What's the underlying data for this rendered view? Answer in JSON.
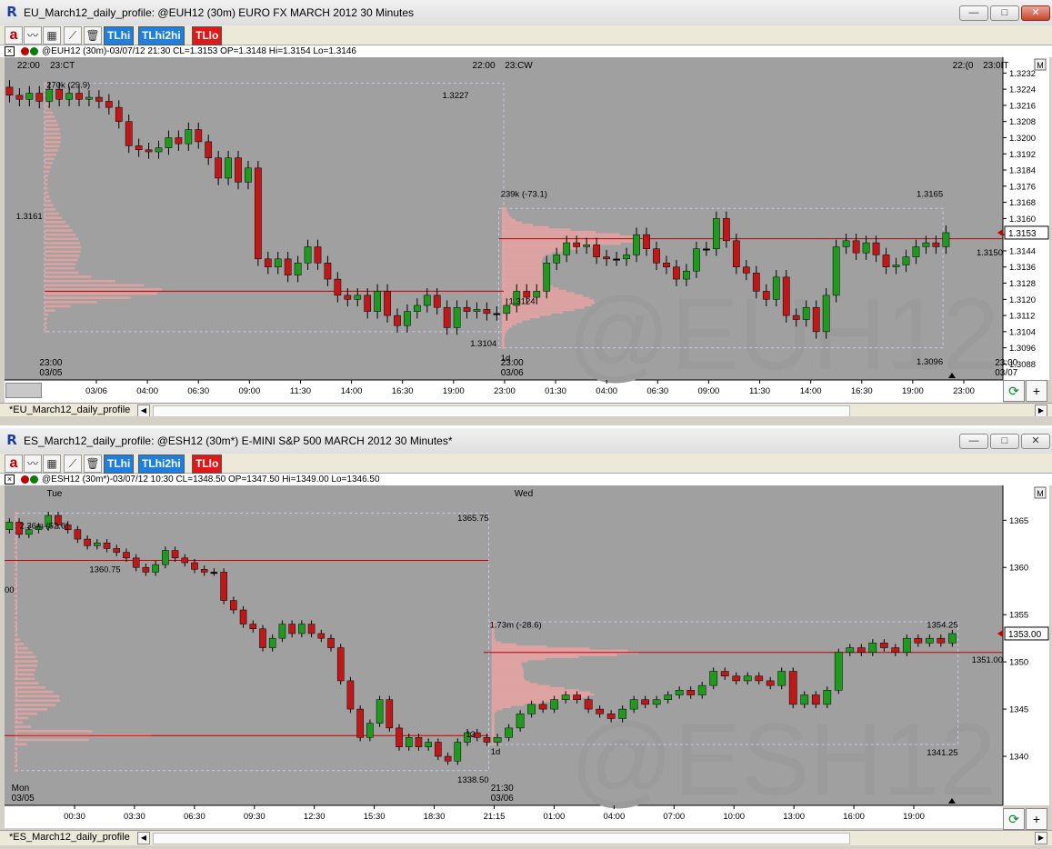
{
  "panes": [
    {
      "title": "EU_March12_daily_profile: @EUH12 (30m) EURO FX MARCH 2012 30 Minutes",
      "app_icon": "R",
      "window_buttons": {
        "minimize": "—",
        "maximize": "□",
        "close": "✕"
      },
      "toolbar": {
        "a_label": "a",
        "tlhi": "TLhi",
        "tlhi2hi": "TLhi2hi",
        "tllo": "TLlo"
      },
      "info": "@EUH12 (30m)-03/07/12 21:30 CL=1.3153 OP=1.3148 Hi=1.3154 Lo=1.3146",
      "tab_name": "*EU_March12_daily_profile",
      "watermark": "@EUH12",
      "top_labels": [
        {
          "text": "22:00",
          "x": 0.024
        },
        {
          "text": "23:CT",
          "x": 0.058
        },
        {
          "text": "22:00",
          "x": 0.48
        },
        {
          "text": "23:CW",
          "x": 0.515
        },
        {
          "text": "22:(0",
          "x": 0.96
        },
        {
          "text": "23:0IT",
          "x": 0.993
        }
      ],
      "profile_labels": [
        {
          "text": "270k (29.9)",
          "xf": 0.042,
          "price": 1.3226
        },
        {
          "text": "1.3227",
          "xf": 0.465,
          "price": 1.3221,
          "anchor": "end"
        },
        {
          "text": "1.3161",
          "xf": 0.038,
          "price": 1.3161,
          "anchor": "end"
        },
        {
          "text": "1.3124",
          "xf": 0.505,
          "price": 1.3119
        },
        {
          "text": "1.3104",
          "xf": 0.493,
          "price": 1.3098,
          "anchor": "end"
        },
        {
          "text": "1d",
          "xf": 0.497,
          "price": 1.3091
        },
        {
          "text": "239k (-73.1)",
          "xf": 0.497,
          "price": 1.3172
        },
        {
          "text": "1.3165",
          "xf": 0.94,
          "price": 1.3172,
          "anchor": "end"
        },
        {
          "text": "1.3150",
          "xf": 1.0,
          "price": 1.3143,
          "anchor": "end"
        },
        {
          "text": "1.3096",
          "xf": 0.94,
          "price": 1.3089,
          "anchor": "end"
        }
      ],
      "date_labels": [
        {
          "t1": "23:00",
          "t2": "03/05",
          "x": 0.035
        },
        {
          "t1": "23:00",
          "t2": "03/06",
          "x": 0.497
        },
        {
          "t1": "23:00",
          "t2": "03/07",
          "x": 0.992
        }
      ],
      "chart_data": {
        "type": "candlestick",
        "ylim": [
          1.3081,
          1.3238
        ],
        "y_ticks": [
          "1.3232",
          "1.3224",
          "1.3216",
          "1.3208",
          "1.3200",
          "1.3192",
          "1.3184",
          "1.3176",
          "1.3168",
          "1.3160",
          "1.3152",
          "1.3144",
          "1.3136",
          "1.3128",
          "1.3120",
          "1.3112",
          "1.3104",
          "1.3096",
          "1.3088"
        ],
        "x_ticks": [
          "03/06",
          "04:00",
          "06:30",
          "09:00",
          "11:30",
          "14:00",
          "16:30",
          "19:00",
          "23:00",
          "01:30",
          "04:00",
          "06:30",
          "09:00",
          "11:30",
          "14:00",
          "16:30",
          "19:00",
          "23:00"
        ],
        "last_price": "1.3153",
        "red_lines": [
          {
            "y": 1.3124,
            "x0": 0.04,
            "x1": 0.5
          },
          {
            "y": 1.315,
            "x0": 0.495,
            "x1": 1.0
          }
        ],
        "profile_boxes": [
          {
            "x0": 0.04,
            "x1": 0.5,
            "y0": 1.3227,
            "y1": 1.3104
          },
          {
            "x0": 0.495,
            "x1": 0.94,
            "y0": 1.3165,
            "y1": 1.3096
          }
        ],
        "candles_day1": [
          [
            1.3225,
            1.3221
          ],
          [
            1.3221,
            1.3219
          ],
          [
            1.3219,
            1.3222
          ],
          [
            1.3222,
            1.3218
          ],
          [
            1.3218,
            1.3224
          ],
          [
            1.3224,
            1.3219
          ],
          [
            1.3219,
            1.3222
          ],
          [
            1.3222,
            1.3219
          ],
          [
            1.3219,
            1.322
          ],
          [
            1.322,
            1.3218
          ],
          [
            1.3218,
            1.3215
          ],
          [
            1.3215,
            1.3208
          ],
          [
            1.3208,
            1.3196
          ],
          [
            1.3196,
            1.3194
          ],
          [
            1.3194,
            1.3193
          ],
          [
            1.3193,
            1.3195
          ],
          [
            1.3195,
            1.32
          ],
          [
            1.32,
            1.3197
          ],
          [
            1.3197,
            1.3204
          ],
          [
            1.3204,
            1.3198
          ],
          [
            1.3198,
            1.319
          ],
          [
            1.319,
            1.318
          ],
          [
            1.318,
            1.319
          ],
          [
            1.319,
            1.3178
          ],
          [
            1.3178,
            1.3185
          ],
          [
            1.3185,
            1.314
          ],
          [
            1.314,
            1.3136
          ],
          [
            1.3136,
            1.314
          ],
          [
            1.314,
            1.3132
          ],
          [
            1.3132,
            1.3138
          ],
          [
            1.3138,
            1.3146
          ],
          [
            1.3146,
            1.3138
          ],
          [
            1.3138,
            1.313
          ],
          [
            1.313,
            1.3122
          ],
          [
            1.3122,
            1.312
          ],
          [
            1.312,
            1.3122
          ],
          [
            1.3122,
            1.3114
          ],
          [
            1.3114,
            1.3124
          ],
          [
            1.3124,
            1.3112
          ],
          [
            1.3112,
            1.3107
          ],
          [
            1.3107,
            1.3114
          ],
          [
            1.3114,
            1.3117
          ],
          [
            1.3117,
            1.3122
          ],
          [
            1.3122,
            1.3116
          ],
          [
            1.3116,
            1.3106
          ],
          [
            1.3106,
            1.3116
          ],
          [
            1.3116,
            1.3114
          ],
          [
            1.3114,
            1.3115
          ],
          [
            1.3115,
            1.3113
          ],
          [
            1.3113,
            1.3113
          ]
        ],
        "candles_day2": [
          [
            1.3113,
            1.3117
          ],
          [
            1.3117,
            1.3124
          ],
          [
            1.3124,
            1.3121
          ],
          [
            1.3121,
            1.3124
          ],
          [
            1.3124,
            1.3138
          ],
          [
            1.3138,
            1.3142
          ],
          [
            1.3142,
            1.3148
          ],
          [
            1.3148,
            1.3146
          ],
          [
            1.3146,
            1.3147
          ],
          [
            1.3147,
            1.3141
          ],
          [
            1.3141,
            1.314
          ],
          [
            1.314,
            1.314
          ],
          [
            1.314,
            1.3142
          ],
          [
            1.3142,
            1.3152
          ],
          [
            1.3152,
            1.3145
          ],
          [
            1.3145,
            1.3138
          ],
          [
            1.3138,
            1.3136
          ],
          [
            1.3136,
            1.313
          ],
          [
            1.313,
            1.3134
          ],
          [
            1.3134,
            1.3145
          ],
          [
            1.3145,
            1.3145
          ],
          [
            1.3145,
            1.316
          ],
          [
            1.316,
            1.3149
          ],
          [
            1.3149,
            1.3136
          ],
          [
            1.3136,
            1.3133
          ],
          [
            1.3133,
            1.3124
          ],
          [
            1.3124,
            1.312
          ],
          [
            1.312,
            1.3131
          ],
          [
            1.3131,
            1.3112
          ],
          [
            1.3112,
            1.311
          ],
          [
            1.311,
            1.3116
          ],
          [
            1.3116,
            1.3104
          ],
          [
            1.3104,
            1.3122
          ],
          [
            1.3122,
            1.3146
          ],
          [
            1.3146,
            1.3149
          ],
          [
            1.3149,
            1.3143
          ],
          [
            1.3143,
            1.3148
          ],
          [
            1.3148,
            1.3142
          ],
          [
            1.3142,
            1.3136
          ],
          [
            1.3136,
            1.3137
          ],
          [
            1.3137,
            1.3141
          ],
          [
            1.3141,
            1.3146
          ],
          [
            1.3146,
            1.3148
          ],
          [
            1.3148,
            1.3146
          ],
          [
            1.3146,
            1.3153
          ]
        ]
      }
    },
    {
      "title": "ES_March12_daily_profile: @ESH12 (30m*) E-MINI S&P 500 MARCH 2012 30 Minutes*",
      "app_icon": "R",
      "window_buttons": {
        "minimize": "—",
        "maximize": "□",
        "close": "✕"
      },
      "toolbar": {
        "a_label": "a",
        "tlhi": "TLhi",
        "tlhi2hi": "TLhi2hi",
        "tllo": "TLlo"
      },
      "info": "@ESH12 (30m*)-03/07/12 10:30 CL=1348.50 OP=1347.50 Hi=1349.00 Lo=1346.50",
      "tab_name": "*ES_March12_daily_profile",
      "watermark": "@ESH12",
      "top_labels": [
        {
          "text": "Tue",
          "x": 0.05
        },
        {
          "text": "Wed",
          "x": 0.52
        }
      ],
      "profile_labels": [
        {
          "text": "2.36m (52.6)",
          "xf": 0.015,
          "price": 1364.4
        },
        {
          "text": "1365.75",
          "xf": 0.485,
          "price": 1365.2,
          "anchor": "end"
        },
        {
          "text": "1360.75",
          "xf": 0.085,
          "price": 1359.8
        },
        {
          "text": "00",
          "xf": 0.0,
          "price": 1357.6
        },
        {
          "text": "1.73m (-28.6)",
          "xf": 0.486,
          "price": 1353.9
        },
        {
          "text": "1354.25",
          "xf": 0.955,
          "price": 1353.9,
          "anchor": "end"
        },
        {
          "text": "1351.00",
          "xf": 1.0,
          "price": 1350.2,
          "anchor": "end"
        },
        {
          "text": "1341.25",
          "xf": 0.955,
          "price": 1340.4,
          "anchor": "end"
        },
        {
          "text": "1338.50",
          "xf": 0.485,
          "price": 1337.5,
          "anchor": "end"
        },
        {
          "text": "1d",
          "xf": 0.487,
          "price": 1340.5
        },
        {
          "text": "13",
          "xf": 0.462,
          "price": 1342.3
        }
      ],
      "date_labels": [
        {
          "t1": "Mon",
          "t2": "03/05",
          "x": 0.007
        },
        {
          "t1": "21:30",
          "t2": "03/06",
          "x": 0.487
        }
      ],
      "chart_data": {
        "type": "candlestick",
        "ylim": [
          1335.0,
          1368.3
        ],
        "y_ticks": [
          "1365",
          "1360",
          "1355",
          "1350",
          "1345",
          "1340"
        ],
        "x_ticks": [
          "00:30",
          "03:30",
          "06:30",
          "09:30",
          "12:30",
          "15:30",
          "18:30",
          "21:15",
          "01:00",
          "04:00",
          "07:00",
          "10:00",
          "13:00",
          "16:00",
          "19:00"
        ],
        "last_price": "1353.00",
        "red_lines": [
          {
            "y": 1360.75,
            "x0": 0.0,
            "x1": 0.485
          },
          {
            "y": 1342.2,
            "x0": 0.0,
            "x1": 0.485
          },
          {
            "y": 1351.0,
            "x0": 0.48,
            "x1": 1.0
          }
        ],
        "profile_boxes": [
          {
            "x0": 0.012,
            "x1": 0.485,
            "y0": 1365.75,
            "y1": 1338.5
          },
          {
            "x0": 0.485,
            "x1": 0.955,
            "y0": 1354.25,
            "y1": 1341.25
          }
        ],
        "candles_day1": [
          [
            1364.0,
            1364.8
          ],
          [
            1364.8,
            1363.5
          ],
          [
            1363.5,
            1364.0
          ],
          [
            1364.0,
            1364.3
          ],
          [
            1364.3,
            1365.5
          ],
          [
            1365.5,
            1364.5
          ],
          [
            1364.5,
            1364.0
          ],
          [
            1364.0,
            1363.0
          ],
          [
            1363.0,
            1362.3
          ],
          [
            1362.3,
            1362.6
          ],
          [
            1362.6,
            1362.0
          ],
          [
            1362.0,
            1361.6
          ],
          [
            1361.6,
            1361.0
          ],
          [
            1361.0,
            1360.0
          ],
          [
            1360.0,
            1359.5
          ],
          [
            1359.5,
            1360.3
          ],
          [
            1360.3,
            1361.8
          ],
          [
            1361.8,
            1361.0
          ],
          [
            1361.0,
            1360.5
          ],
          [
            1360.5,
            1359.8
          ],
          [
            1359.8,
            1359.5
          ],
          [
            1359.5,
            1359.5
          ],
          [
            1359.5,
            1356.5
          ],
          [
            1356.5,
            1355.5
          ],
          [
            1355.5,
            1354.0
          ],
          [
            1354.0,
            1353.5
          ],
          [
            1353.5,
            1351.5
          ],
          [
            1351.5,
            1352.5
          ],
          [
            1352.5,
            1354.0
          ],
          [
            1354.0,
            1353.0
          ],
          [
            1353.0,
            1354.0
          ],
          [
            1354.0,
            1353.0
          ],
          [
            1353.0,
            1352.5
          ],
          [
            1352.5,
            1351.5
          ],
          [
            1351.5,
            1348.0
          ],
          [
            1348.0,
            1345.0
          ],
          [
            1345.0,
            1342.0
          ],
          [
            1342.0,
            1343.5
          ],
          [
            1343.5,
            1346.0
          ],
          [
            1346.0,
            1343.0
          ],
          [
            1343.0,
            1341.0
          ],
          [
            1341.0,
            1342.0
          ],
          [
            1342.0,
            1341.0
          ],
          [
            1341.0,
            1341.5
          ],
          [
            1341.5,
            1340.0
          ],
          [
            1340.0,
            1339.5
          ],
          [
            1339.5,
            1341.5
          ],
          [
            1341.5,
            1342.5
          ],
          [
            1342.5,
            1342.0
          ],
          [
            1342.0,
            1341.5
          ]
        ],
        "candles_day2": [
          [
            1341.5,
            1342.0
          ],
          [
            1342.0,
            1343.0
          ],
          [
            1343.0,
            1344.5
          ],
          [
            1344.5,
            1345.5
          ],
          [
            1345.5,
            1345.0
          ],
          [
            1345.0,
            1346.0
          ],
          [
            1346.0,
            1346.5
          ],
          [
            1346.5,
            1346.0
          ],
          [
            1346.0,
            1345.0
          ],
          [
            1345.0,
            1344.5
          ],
          [
            1344.5,
            1344.0
          ],
          [
            1344.0,
            1345.0
          ],
          [
            1345.0,
            1346.0
          ],
          [
            1346.0,
            1345.5
          ],
          [
            1345.5,
            1346.0
          ],
          [
            1346.0,
            1346.5
          ],
          [
            1346.5,
            1347.0
          ],
          [
            1347.0,
            1346.5
          ],
          [
            1346.5,
            1347.5
          ],
          [
            1347.5,
            1349.0
          ],
          [
            1349.0,
            1348.5
          ],
          [
            1348.5,
            1348.0
          ],
          [
            1348.0,
            1348.5
          ],
          [
            1348.5,
            1348.0
          ],
          [
            1348.0,
            1347.5
          ],
          [
            1347.5,
            1349.0
          ],
          [
            1349.0,
            1345.5
          ],
          [
            1345.5,
            1346.5
          ],
          [
            1346.5,
            1345.5
          ],
          [
            1345.5,
            1347.0
          ],
          [
            1347.0,
            1351.0
          ],
          [
            1351.0,
            1351.5
          ],
          [
            1351.5,
            1351.0
          ],
          [
            1351.0,
            1352.0
          ],
          [
            1352.0,
            1351.5
          ],
          [
            1351.5,
            1351.0
          ],
          [
            1351.0,
            1352.5
          ],
          [
            1352.5,
            1352.0
          ],
          [
            1352.0,
            1352.5
          ],
          [
            1352.5,
            1352.0
          ],
          [
            1352.0,
            1353.0
          ]
        ]
      }
    }
  ]
}
